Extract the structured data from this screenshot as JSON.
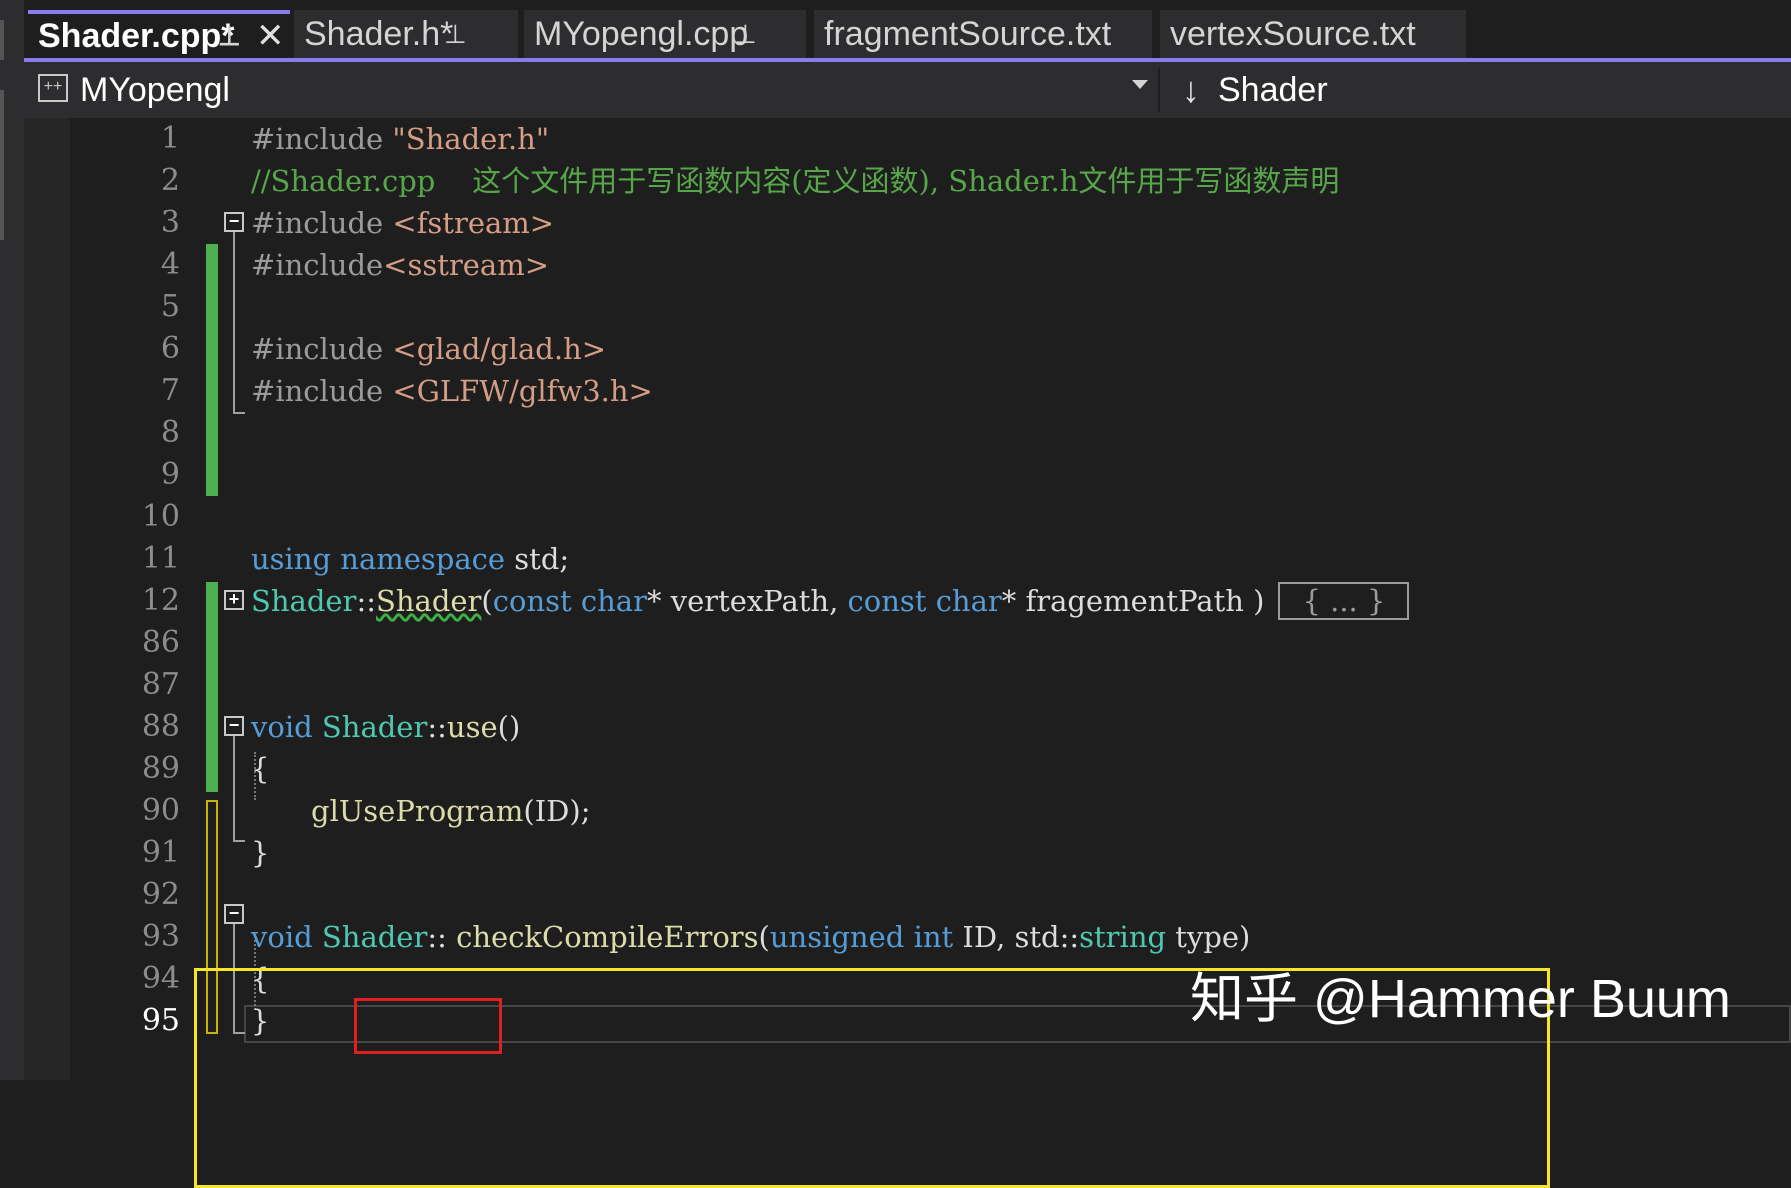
{
  "tabs": [
    {
      "label": "Shader.cpp*",
      "active": true,
      "pinned": true,
      "closable": true
    },
    {
      "label": "Shader.h*",
      "active": false,
      "pinned": true
    },
    {
      "label": "MYopengl.cpp",
      "active": false,
      "pinned": true
    },
    {
      "label": "fragmentSource.txt",
      "active": false,
      "pinned": false
    },
    {
      "label": "vertexSource.txt",
      "active": false,
      "pinned": false
    }
  ],
  "nav": {
    "project": "MYopengl",
    "scope_icon": "↓",
    "scope": "Shader"
  },
  "icons": {
    "pin": "pin-icon",
    "close": "close-icon",
    "project": "cpp-project-icon",
    "dropdown": "chevron-down-icon",
    "scope": "down-arrow-icon",
    "fold_collapse": "minus-box-icon",
    "fold_expand": "plus-box-icon"
  },
  "colors": {
    "accent": "#8a7cf0",
    "keyword": "#569cd6",
    "string": "#d69d85",
    "comment": "#57a64a",
    "type": "#4ec9b0",
    "function": "#dcdcaa",
    "highlight_yellow": "#f5e629",
    "highlight_red": "#e02020",
    "change_green": "#4caf50"
  },
  "code": {
    "current_line": "95",
    "lines": [
      {
        "no": "1",
        "text": "#include \"Shader.h\""
      },
      {
        "no": "2",
        "text": "//Shader.cpp    这个文件用于写函数内容(定义函数), Shader.h文件用于写函数声明"
      },
      {
        "no": "3",
        "text": "#include <fstream>"
      },
      {
        "no": "4",
        "text": "#include<sstream>"
      },
      {
        "no": "5",
        "text": ""
      },
      {
        "no": "6",
        "text": "#include <glad/glad.h>"
      },
      {
        "no": "7",
        "text": "#include <GLFW/glfw3.h>"
      },
      {
        "no": "8",
        "text": ""
      },
      {
        "no": "9",
        "text": ""
      },
      {
        "no": "10",
        "text": ""
      },
      {
        "no": "11",
        "text": "using namespace std;"
      },
      {
        "no": "12",
        "text": "Shader::Shader(const char* vertexPath, const char* fragementPath ){ ... }"
      },
      {
        "no": "86",
        "text": ""
      },
      {
        "no": "87",
        "text": "void Shader::use()"
      },
      {
        "no": "88",
        "text": "{"
      },
      {
        "no": "89",
        "text": "    glUseProgram(ID);"
      },
      {
        "no": "90",
        "text": "}"
      },
      {
        "no": "91",
        "text": ""
      },
      {
        "no": "92",
        "text": "void Shader:: checkCompileErrors(unsigned int ID, std::string type)"
      },
      {
        "no": "93",
        "text": "{"
      },
      {
        "no": "94",
        "text": ""
      },
      {
        "no": "95",
        "text": "}"
      }
    ],
    "tokens": {
      "l1_pre": "#include ",
      "l1_str": "\"Shader.h\"",
      "l2_com": "//Shader.cpp    这个文件用于写函数内容(定义函数), Shader.h文件用于写函数声明",
      "l3_pre": "#include ",
      "l3_str": "<fstream>",
      "l4_pre": "#include",
      "l4_str": "<sstream>",
      "l6_pre": "#include ",
      "l6_str": "<glad/glad.h>",
      "l7_pre": "#include ",
      "l7_str": "<GLFW/glfw3.h>",
      "l11_kw1": "using",
      "l11_kw2": "namespace",
      "l11_rest": " std;",
      "l12_type": "Shader",
      "l12_sep": "::",
      "l12_fn": "Shader",
      "l12_p1": "(",
      "l12_kw1": "const",
      "l12_kw2": "char",
      "l12_arg1": "* vertexPath, ",
      "l12_kw3": "const",
      "l12_kw4": "char",
      "l12_arg2": "* fragementPath )",
      "l12_collapsed": "{ ... }",
      "l87_kw": "void",
      "l87_type": "Shader",
      "l87_sep": "::",
      "l87_fn": "use",
      "l87_par": "()",
      "l88": "{",
      "l89_fn": "glUseProgram",
      "l89_rest": "(ID);",
      "l90": "}",
      "l92_kw": "void",
      "l92_type": "Shader",
      "l92_sep": "::",
      "l92_fn": "checkCompileErrors",
      "l92_p1": "(",
      "l92_kw2": "unsigned",
      "l92_kw3": "int",
      "l92_arg1": " ID, std::",
      "l92_type2": "string",
      "l92_arg2": " type)",
      "l93": "{",
      "l95": "}"
    }
  },
  "watermark": "知乎 @Hammer Buum"
}
